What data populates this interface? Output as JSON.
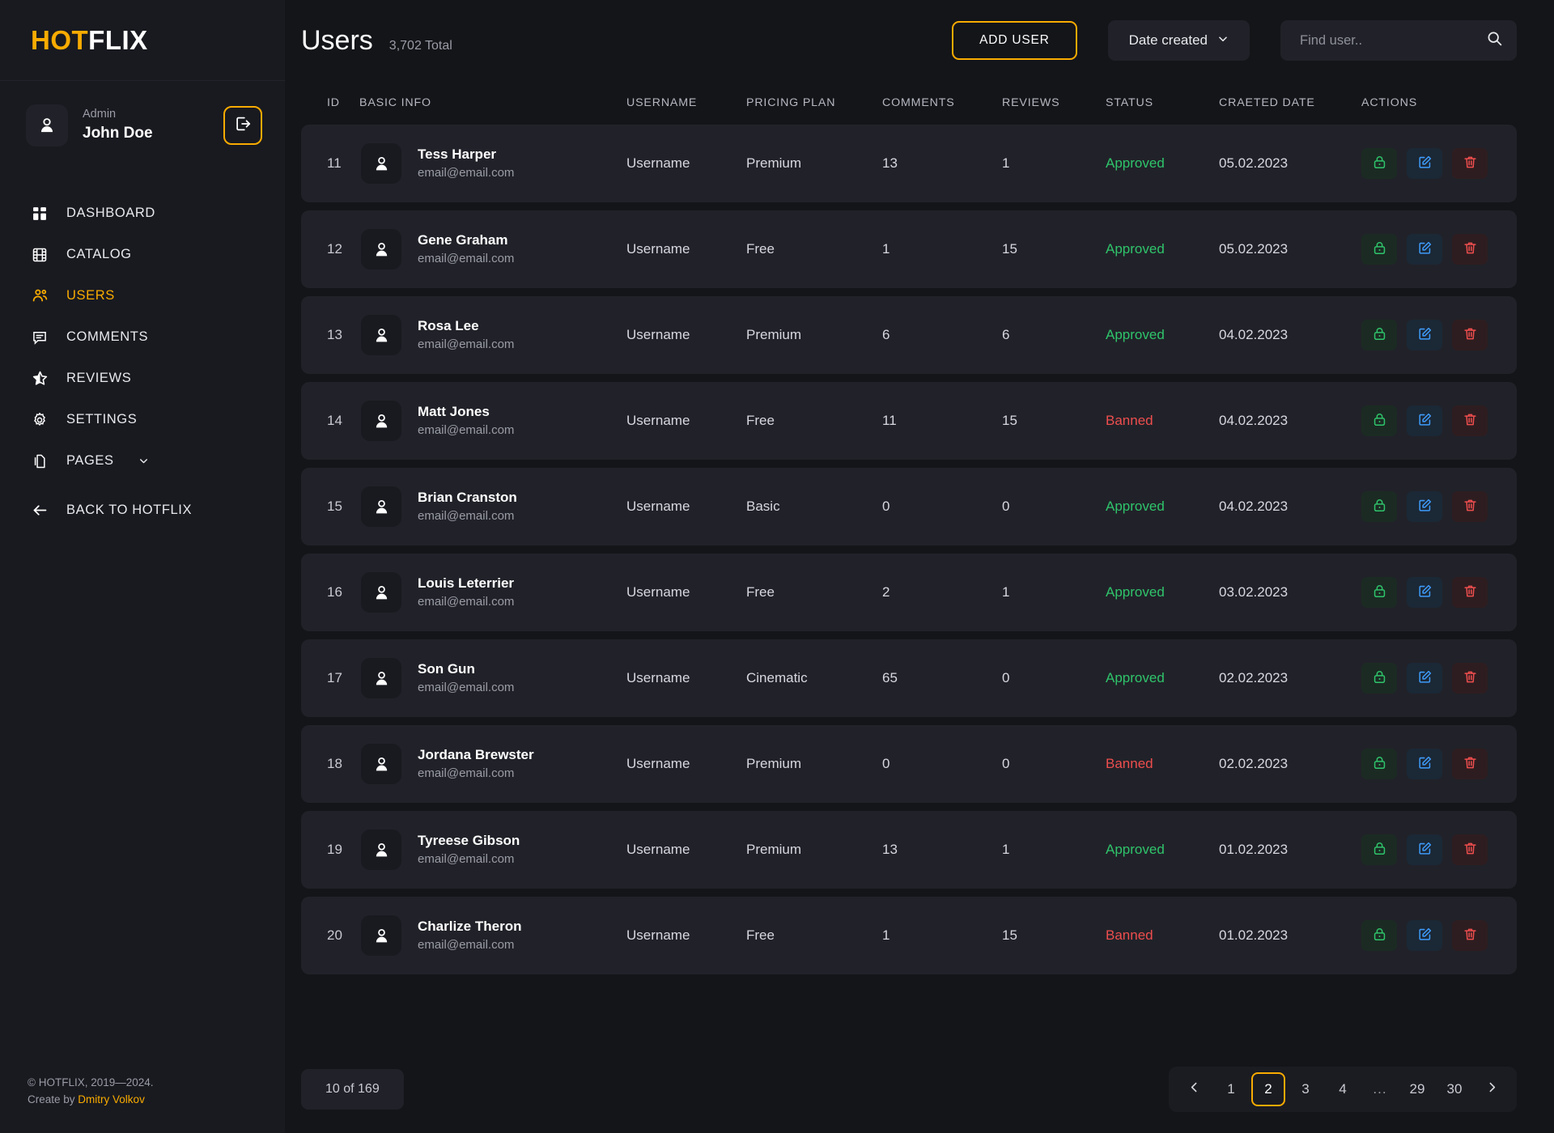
{
  "brand": {
    "part1": "HOT",
    "part2": "FLIX"
  },
  "account": {
    "role": "Admin",
    "name": "John Doe",
    "logout_label": "logout-icon"
  },
  "sidebar": {
    "items": [
      {
        "label": "DASHBOARD",
        "icon": "grid-icon",
        "active": false
      },
      {
        "label": "CATALOG",
        "icon": "film-icon",
        "active": false
      },
      {
        "label": "USERS",
        "icon": "users-icon",
        "active": true
      },
      {
        "label": "COMMENTS",
        "icon": "comment-icon",
        "active": false
      },
      {
        "label": "REVIEWS",
        "icon": "star-icon",
        "active": false
      },
      {
        "label": "SETTINGS",
        "icon": "gear-icon",
        "active": false
      },
      {
        "label": "PAGES",
        "icon": "pages-icon",
        "active": false,
        "chevron": true
      },
      {
        "label": "BACK TO HOTFLIX",
        "icon": "arrow-left-icon",
        "active": false
      }
    ]
  },
  "footer": {
    "copyright": "© HOTFLIX, 2019—2024.",
    "create_by": "Create by",
    "author": "Dmitry Volkov"
  },
  "header": {
    "title": "Users",
    "total": "3,702 Total",
    "add_user_label": "ADD USER",
    "sort_label": "Date created",
    "search_placeholder": "Find user..",
    "search_value": ""
  },
  "table": {
    "columns": [
      "ID",
      "BASIC INFO",
      "USERNAME",
      "PRICING PLAN",
      "COMMENTS",
      "REVIEWS",
      "STATUS",
      "CRAETED DATE",
      "ACTIONS"
    ],
    "rows": [
      {
        "id": "11",
        "name": "Tess Harper",
        "email": "email@email.com",
        "username": "Username",
        "plan": "Premium",
        "comments": "13",
        "reviews": "1",
        "status": "Approved",
        "date": "05.02.2023"
      },
      {
        "id": "12",
        "name": "Gene Graham",
        "email": "email@email.com",
        "username": "Username",
        "plan": "Free",
        "comments": "1",
        "reviews": "15",
        "status": "Approved",
        "date": "05.02.2023"
      },
      {
        "id": "13",
        "name": "Rosa Lee",
        "email": "email@email.com",
        "username": "Username",
        "plan": "Premium",
        "comments": "6",
        "reviews": "6",
        "status": "Approved",
        "date": "04.02.2023"
      },
      {
        "id": "14",
        "name": "Matt Jones",
        "email": "email@email.com",
        "username": "Username",
        "plan": "Free",
        "comments": "11",
        "reviews": "15",
        "status": "Banned",
        "date": "04.02.2023"
      },
      {
        "id": "15",
        "name": "Brian Cranston",
        "email": "email@email.com",
        "username": "Username",
        "plan": "Basic",
        "comments": "0",
        "reviews": "0",
        "status": "Approved",
        "date": "04.02.2023"
      },
      {
        "id": "16",
        "name": "Louis Leterrier",
        "email": "email@email.com",
        "username": "Username",
        "plan": "Free",
        "comments": "2",
        "reviews": "1",
        "status": "Approved",
        "date": "03.02.2023"
      },
      {
        "id": "17",
        "name": "Son Gun",
        "email": "email@email.com",
        "username": "Username",
        "plan": "Cinematic",
        "comments": "65",
        "reviews": "0",
        "status": "Approved",
        "date": "02.02.2023"
      },
      {
        "id": "18",
        "name": "Jordana Brewster",
        "email": "email@email.com",
        "username": "Username",
        "plan": "Premium",
        "comments": "0",
        "reviews": "0",
        "status": "Banned",
        "date": "02.02.2023"
      },
      {
        "id": "19",
        "name": "Tyreese Gibson",
        "email": "email@email.com",
        "username": "Username",
        "plan": "Premium",
        "comments": "13",
        "reviews": "1",
        "status": "Approved",
        "date": "01.02.2023"
      },
      {
        "id": "20",
        "name": "Charlize Theron",
        "email": "email@email.com",
        "username": "Username",
        "plan": "Free",
        "comments": "1",
        "reviews": "15",
        "status": "Banned",
        "date": "01.02.2023"
      }
    ],
    "row_actions": [
      {
        "icon": "lock-icon",
        "kind": "lock"
      },
      {
        "icon": "edit-icon",
        "kind": "edit"
      },
      {
        "icon": "trash-icon",
        "kind": "delete"
      }
    ]
  },
  "bottom": {
    "per_page": "10 of 169",
    "pagination": {
      "prev": "chevron-left-icon",
      "next": "chevron-right-icon",
      "pages": [
        "1",
        "2",
        "3",
        "4",
        "...",
        "29",
        "30"
      ],
      "current": "2"
    }
  },
  "colors": {
    "accent": "#F9AB00",
    "approved": "#2FC46B",
    "banned": "#EE4E4E",
    "sidebar_bg": "#191A20",
    "main_bg": "#141519",
    "row_bg": "#212229"
  }
}
